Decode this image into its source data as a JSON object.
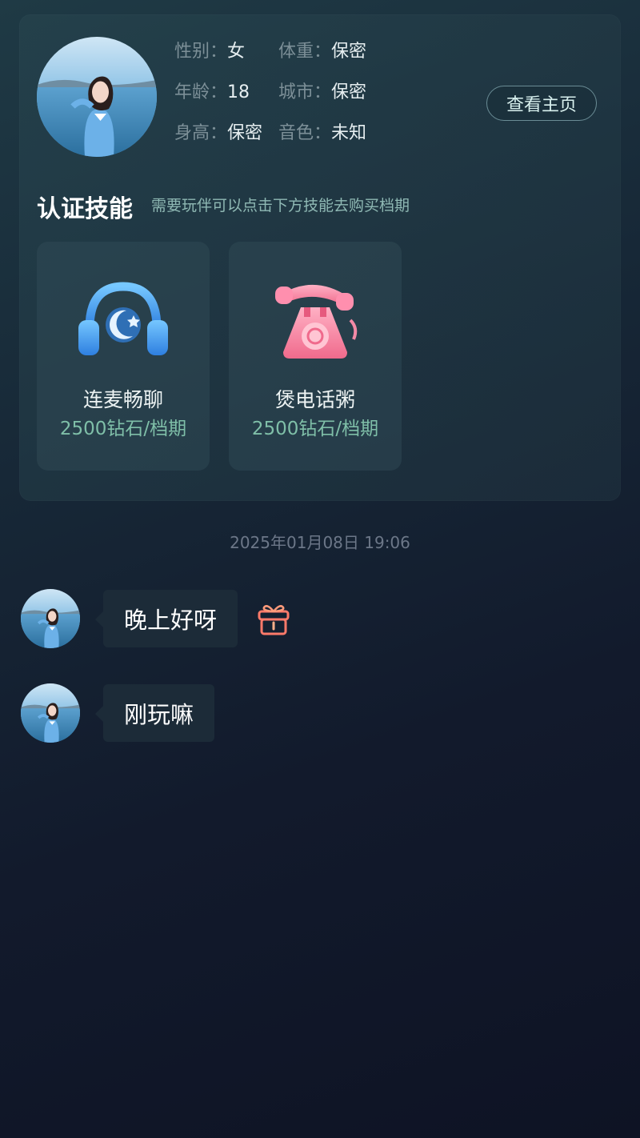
{
  "profile": {
    "info": [
      {
        "label": "性别",
        "sep": "：",
        "value": "女"
      },
      {
        "label": "体重",
        "sep": "：",
        "value": "保密"
      },
      {
        "label": "年龄",
        "sep": "：",
        "value": "18"
      },
      {
        "label": "城市",
        "sep": "：",
        "value": "保密"
      },
      {
        "label": "身高",
        "sep": "：",
        "value": "保密"
      },
      {
        "label": "音色",
        "sep": "：",
        "value": "未知"
      }
    ],
    "view_home_label": "查看主页"
  },
  "skills": {
    "title": "认证技能",
    "hint": "需要玩伴可以点击下方技能去购买档期",
    "items": [
      {
        "name": "连麦畅聊",
        "price": "2500钻石/档期",
        "icon": "headphones-moon-icon"
      },
      {
        "name": "煲电话粥",
        "price": "2500钻石/档期",
        "icon": "telephone-icon"
      }
    ]
  },
  "chat": {
    "timestamp": "2025年01月08日 19:06",
    "messages": [
      {
        "text": "晚上好呀",
        "gift_icon": "gift-icon"
      },
      {
        "text": "刚玩嘛"
      }
    ]
  },
  "colors": {
    "accent_price": "#7fbfa8",
    "hint_text": "#8fb9b4",
    "bubble_bg": "#1c2b38",
    "gift": "#ff7a6a"
  }
}
